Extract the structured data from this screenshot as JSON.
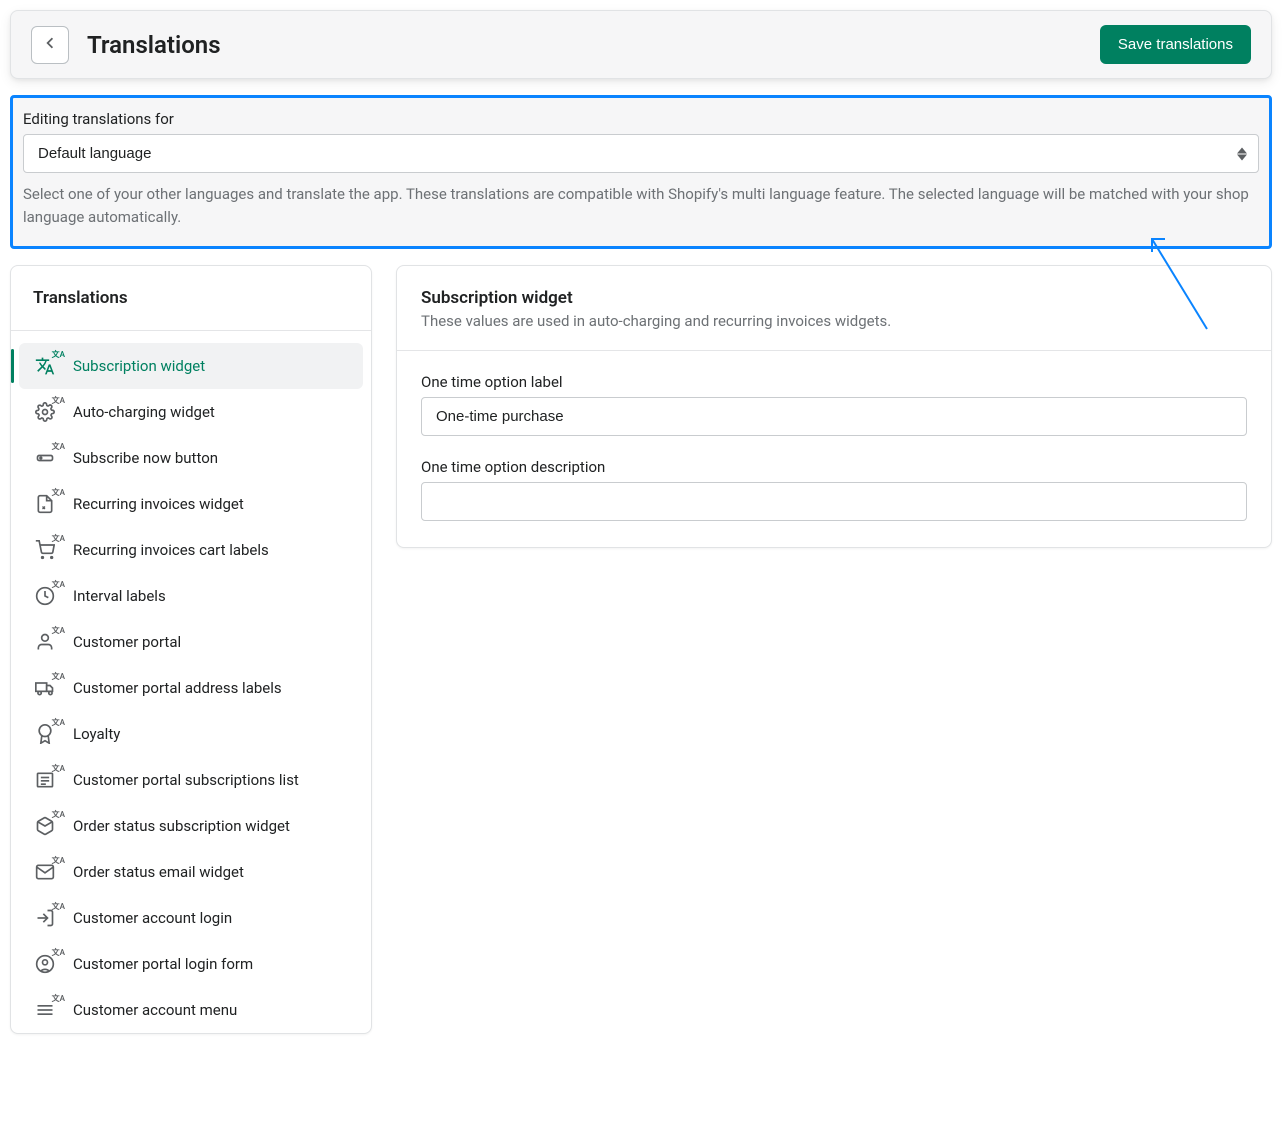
{
  "header": {
    "title": "Translations",
    "save_label": "Save translations"
  },
  "language_box": {
    "label": "Editing translations for",
    "selected": "Default language",
    "help": "Select one of your other languages and translate the app. These translations are compatible with Shopify's multi language feature. The selected language will be matched with your shop language automatically."
  },
  "sidebar": {
    "heading": "Translations",
    "items": [
      {
        "label": "Subscription widget",
        "active": true,
        "icon": "translate"
      },
      {
        "label": "Auto-charging widget",
        "icon": "gear"
      },
      {
        "label": "Subscribe now button",
        "icon": "button"
      },
      {
        "label": "Recurring invoices widget",
        "icon": "invoice"
      },
      {
        "label": "Recurring invoices cart labels",
        "icon": "cart"
      },
      {
        "label": "Interval labels",
        "icon": "clock"
      },
      {
        "label": "Customer portal",
        "icon": "person"
      },
      {
        "label": "Customer portal address labels",
        "icon": "truck"
      },
      {
        "label": "Loyalty",
        "icon": "badge"
      },
      {
        "label": "Customer portal subscriptions list",
        "icon": "list"
      },
      {
        "label": "Order status subscription widget",
        "icon": "package"
      },
      {
        "label": "Order status email widget",
        "icon": "mail"
      },
      {
        "label": "Customer account login",
        "icon": "login"
      },
      {
        "label": "Customer portal login form",
        "icon": "form"
      },
      {
        "label": "Customer account menu",
        "icon": "menu"
      }
    ]
  },
  "main": {
    "title": "Subscription widget",
    "sub": "These values are used in auto-charging and recurring invoices widgets.",
    "fields": {
      "one_time_label": {
        "label": "One time option label",
        "value": "One-time purchase"
      },
      "one_time_desc": {
        "label": "One time option description",
        "value": ""
      }
    }
  }
}
